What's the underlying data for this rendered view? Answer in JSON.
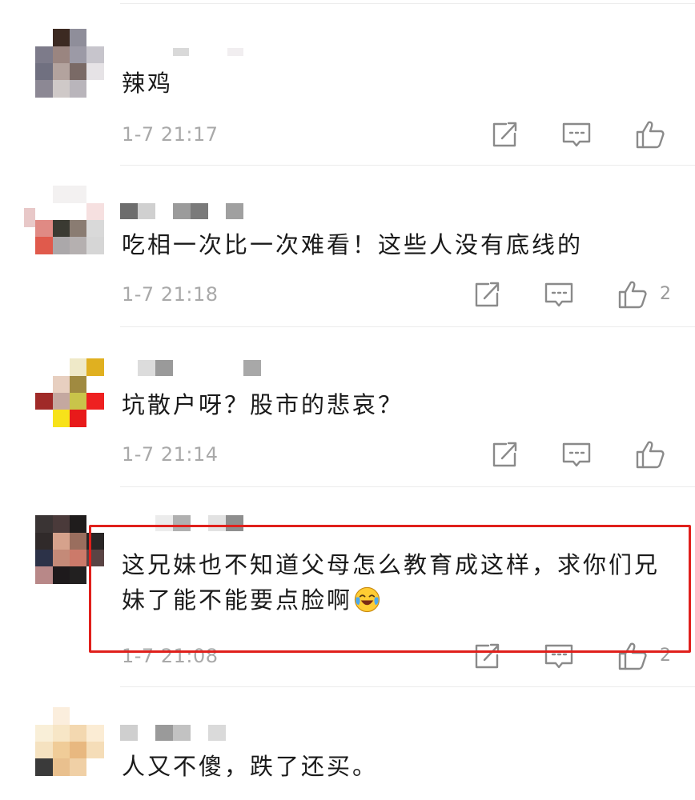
{
  "comments": [
    {
      "text": "辣鸡",
      "time": "1-7 21:17",
      "likes": ""
    },
    {
      "text": "吃相一次比一次难看！这些人没有底线的",
      "time": "1-7 21:18",
      "likes": "2"
    },
    {
      "text": "坑散户呀？股市的悲哀？",
      "time": "1-7 21:14",
      "likes": ""
    },
    {
      "text": "这兄妹也不知道父母怎么教育成这样，求你们兄妹了能不能要点脸啊",
      "time": "1-7 21:08",
      "likes": "2",
      "emoji": "crying-laughing-emoji",
      "highlighted": true
    },
    {
      "text": "人又不傻，跌了还买。",
      "time": "",
      "likes": ""
    }
  ],
  "icons": {
    "share": "share-icon",
    "reply": "comment-icon",
    "like": "thumbs-up-icon"
  },
  "colors": {
    "highlight_border": "#e0201c",
    "meta_text": "#a9a9a9",
    "icon_stroke": "#8a8a8a"
  }
}
